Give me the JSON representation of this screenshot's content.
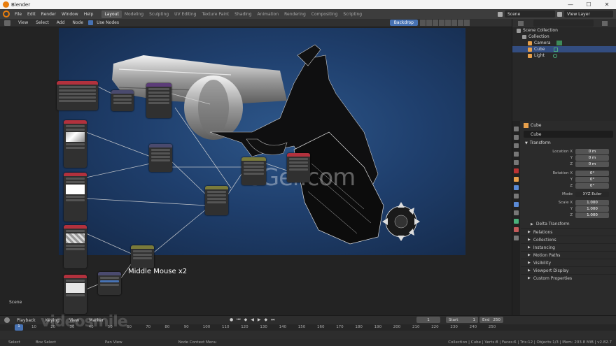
{
  "window": {
    "title": "Blender",
    "controls": [
      "—",
      "☐",
      "✕"
    ]
  },
  "menu": [
    "File",
    "Edit",
    "Render",
    "Window",
    "Help"
  ],
  "workspaces": [
    "Layout",
    "Modeling",
    "Sculpting",
    "UV Editing",
    "Texture Paint",
    "Shading",
    "Animation",
    "Rendering",
    "Compositing",
    "Scripting"
  ],
  "active_workspace": "Layout",
  "scene": {
    "label": "Scene",
    "view_layer": "View Layer"
  },
  "node_editor": {
    "menu": [
      "View",
      "Select",
      "Add",
      "Node"
    ],
    "use_nodes": "Use Nodes",
    "backdrop": "Backdrop",
    "hint": "Middle Mouse x2",
    "scene_label": "Scene",
    "watermark": "CGer.com"
  },
  "outliner": {
    "rows": [
      {
        "label": "Scene Collection",
        "color": "#9a9a9a"
      },
      {
        "label": "Collection",
        "color": "#9a9a9a"
      },
      {
        "label": "Camera",
        "color": "#e8a04b"
      },
      {
        "label": "Cube",
        "color": "#e8a04b"
      },
      {
        "label": "Light",
        "color": "#e8a04b"
      }
    ],
    "selected": "Cube"
  },
  "properties": {
    "object": "Cube",
    "name_value": "Cube",
    "transform_title": "Transform",
    "location": [
      {
        "label": "Location X",
        "value": "0 m"
      },
      {
        "label": "Y",
        "value": "0 m"
      },
      {
        "label": "Z",
        "value": "0 m"
      }
    ],
    "rotation": [
      {
        "label": "Rotation X",
        "value": "0°"
      },
      {
        "label": "Y",
        "value": "0°"
      },
      {
        "label": "Z",
        "value": "0°"
      }
    ],
    "mode_label": "Mode",
    "mode_value": "XYZ Euler",
    "scale": [
      {
        "label": "Scale X",
        "value": "1.000"
      },
      {
        "label": "Y",
        "value": "1.000"
      },
      {
        "label": "Z",
        "value": "1.000"
      }
    ],
    "delta": "Delta Transform",
    "panels": [
      "Relations",
      "Collections",
      "Instancing",
      "Motion Paths",
      "Visibility",
      "Viewport Display",
      "Custom Properties"
    ]
  },
  "timeline": {
    "menu": [
      "Playback",
      "Keying",
      "View",
      "Marker"
    ],
    "current_frame": "1",
    "start_label": "Start",
    "start": "1",
    "end_label": "End",
    "end": "250",
    "cursor": "1",
    "ticks": [
      "10",
      "20",
      "30",
      "40",
      "50",
      "60",
      "70",
      "80",
      "90",
      "100",
      "110",
      "120",
      "130",
      "140",
      "150",
      "160",
      "170",
      "180",
      "190",
      "200",
      "210",
      "220",
      "230",
      "240",
      "250"
    ],
    "watermark": "videosmile"
  },
  "status": {
    "items": [
      "Select",
      "Box Select",
      "Pan View",
      "Node Context Menu"
    ],
    "right": "Collection | Cube | Verts:8 | Faces:6 | Tris:12 | Objects:1/3 | Mem: 203.8 MiB | v2.82.7"
  }
}
